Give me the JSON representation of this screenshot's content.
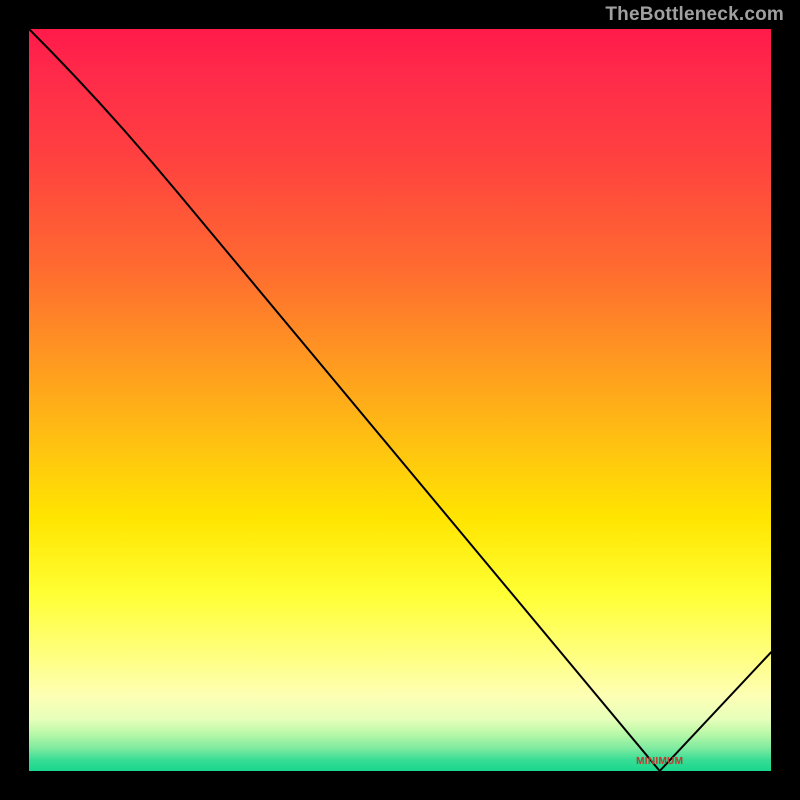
{
  "watermark": "TheBottleneck.com",
  "chart_data": {
    "type": "line",
    "title": "",
    "xlabel": "",
    "ylabel": "",
    "xlim": [
      0,
      100
    ],
    "ylim": [
      0,
      100
    ],
    "x": [
      0,
      20,
      85,
      100
    ],
    "y": [
      100,
      78,
      0,
      16
    ],
    "minimum": {
      "x": 85,
      "y": 0,
      "label": "MINIMUM"
    },
    "background": "heatmap-gradient red→yellow→green (top→bottom)"
  }
}
